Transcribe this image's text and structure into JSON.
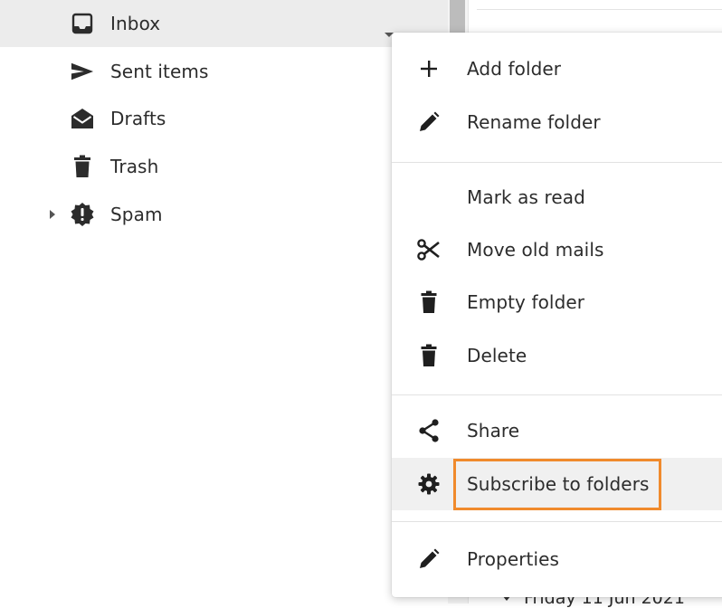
{
  "folders": [
    {
      "label": "Inbox",
      "icon": "inbox-icon",
      "selected": true
    },
    {
      "label": "Sent items",
      "icon": "send-icon",
      "selected": false
    },
    {
      "label": "Drafts",
      "icon": "envelope-open-icon",
      "selected": false
    },
    {
      "label": "Trash",
      "icon": "trash-icon",
      "selected": false
    },
    {
      "label": "Spam",
      "icon": "spam-badge-icon",
      "selected": false,
      "collapsible": true
    }
  ],
  "context_menu": {
    "items": [
      {
        "label": "Add folder",
        "icon": "plus-icon"
      },
      {
        "label": "Rename folder",
        "icon": "pencil-icon"
      },
      {
        "label": "Mark as read",
        "icon": ""
      },
      {
        "label": "Move old mails",
        "icon": "scissors-icon"
      },
      {
        "label": "Empty folder",
        "icon": "trash-icon"
      },
      {
        "label": "Delete",
        "icon": "trash-icon"
      },
      {
        "label": "Share",
        "icon": "share-icon"
      },
      {
        "label": "Subscribe to folders",
        "icon": "gear-icon",
        "highlighted": true
      },
      {
        "label": "Properties",
        "icon": "pencil-icon"
      }
    ]
  },
  "content": {
    "date_header": "Friday 11 Jun 2021"
  },
  "colors": {
    "highlight": "#f08a2c",
    "selected_row": "#ececec",
    "hover_row": "#f0f0f0",
    "text": "#2c2c2c"
  }
}
